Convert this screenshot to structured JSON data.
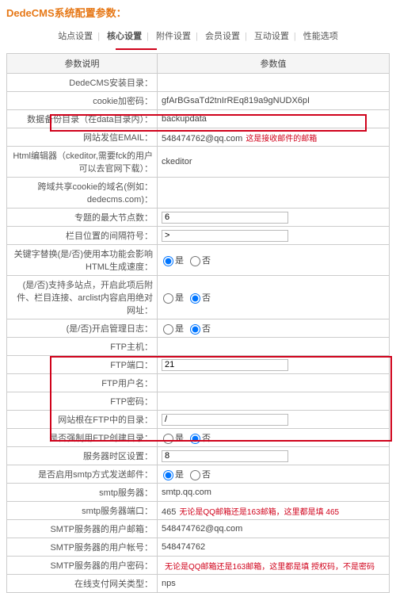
{
  "page_title": "DedeCMS系统配置参数：",
  "tabs": {
    "t0": "站点设置",
    "t1": "核心设置",
    "t2": "附件设置",
    "t3": "会员设置",
    "t4": "互动设置",
    "t5": "性能选项"
  },
  "headers": {
    "param": "参数说明",
    "value": "参数值"
  },
  "rows": {
    "r0": {
      "label": "DedeCMS安装目录：",
      "value": ""
    },
    "r1": {
      "label": "cookie加密码：",
      "value": "gfArBGsaTd2tnIrREq819a9gNUDX6pI"
    },
    "r2": {
      "label": "数据备份目录（在data目录内）：",
      "value": "backupdata"
    },
    "r3": {
      "label": "网站发信EMAIL：",
      "value": "548474762@qq.com",
      "note": "这是接收邮件的邮箱"
    },
    "r4": {
      "label": "Html编辑器（ckeditor,需要fck的用户可以去官网下载）：",
      "value": "ckeditor"
    },
    "r5": {
      "label": "跨域共享cookie的域名(例如：dedecms.com)：",
      "value": ""
    },
    "r6": {
      "label": "专题的最大节点数：",
      "value": "6"
    },
    "r7": {
      "label": "栏目位置的间隔符号：",
      "value": ">"
    },
    "r8": {
      "label": "关键字替换(是/否)使用本功能会影响HTML生成速度：",
      "yes": "是",
      "no": "否"
    },
    "r9": {
      "label": "(是/否)支持多站点，开启此项后附件、栏目连接、arclist内容启用绝对网址：",
      "yes": "是",
      "no": "否"
    },
    "r10": {
      "label": "(是/否)开启管理日志：",
      "yes": "是",
      "no": "否"
    },
    "r11": {
      "label": "FTP主机：",
      "value": ""
    },
    "r12": {
      "label": "FTP端口：",
      "value": "21"
    },
    "r13": {
      "label": "FTP用户名：",
      "value": ""
    },
    "r14": {
      "label": "FTP密码：",
      "value": ""
    },
    "r15": {
      "label": "网站根在FTP中的目录：",
      "value": "/"
    },
    "r16": {
      "label": "是否强制用FTP创建目录：",
      "yes": "是",
      "no": "否"
    },
    "r17": {
      "label": "服务器时区设置：",
      "value": "8"
    },
    "r18": {
      "label": "是否启用smtp方式发送邮件：",
      "yes": "是",
      "no": "否"
    },
    "r19": {
      "label": "smtp服务器：",
      "value": "smtp.qq.com"
    },
    "r20": {
      "label": "smtp服务器端口：",
      "value": "465",
      "note": "无论是QQ邮箱还是163邮箱，这里都是填 465"
    },
    "r21": {
      "label": "SMTP服务器的用户邮箱：",
      "value": "548474762@qq.com"
    },
    "r22": {
      "label": "SMTP服务器的用户帐号：",
      "value": "548474762"
    },
    "r23": {
      "label": "SMTP服务器的用户密码：",
      "note": "无论是QQ邮箱还是163邮箱，这里都是填 授权码，不是密码"
    },
    "r24": {
      "label": "在线支付网关类型：",
      "value": "nps"
    }
  }
}
